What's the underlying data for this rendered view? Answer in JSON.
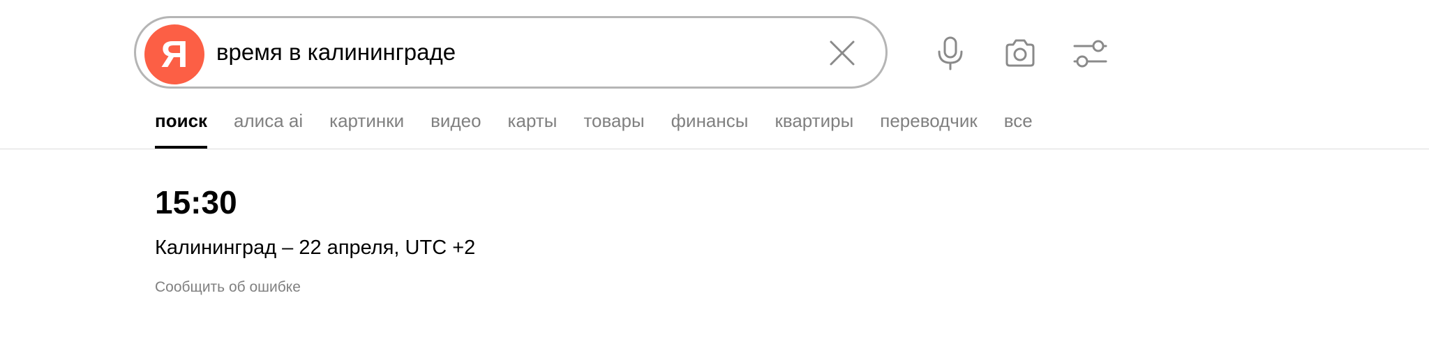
{
  "logo": {
    "letter": "Я"
  },
  "search": {
    "query": "время в калининграде"
  },
  "toolbar": {
    "clear_icon": "close-icon",
    "mic_icon": "microphone-icon",
    "camera_icon": "camera-icon",
    "filters_icon": "filters-icon"
  },
  "tabs": [
    {
      "label": "поиск",
      "active": true
    },
    {
      "label": "алиса ai"
    },
    {
      "label": "картинки"
    },
    {
      "label": "видео"
    },
    {
      "label": "карты"
    },
    {
      "label": "товары"
    },
    {
      "label": "финансы"
    },
    {
      "label": "квартиры"
    },
    {
      "label": "переводчик"
    },
    {
      "label": "все"
    }
  ],
  "result": {
    "time": "15:30",
    "place": "Калининград – 22 апреля, UTC +2",
    "report_link": "Сообщить об ошибке"
  },
  "colors": {
    "logo_bg": "#fc5f45",
    "border": "#b5b5b5",
    "muted_text": "#808080",
    "icon": "#8a8a8a"
  }
}
